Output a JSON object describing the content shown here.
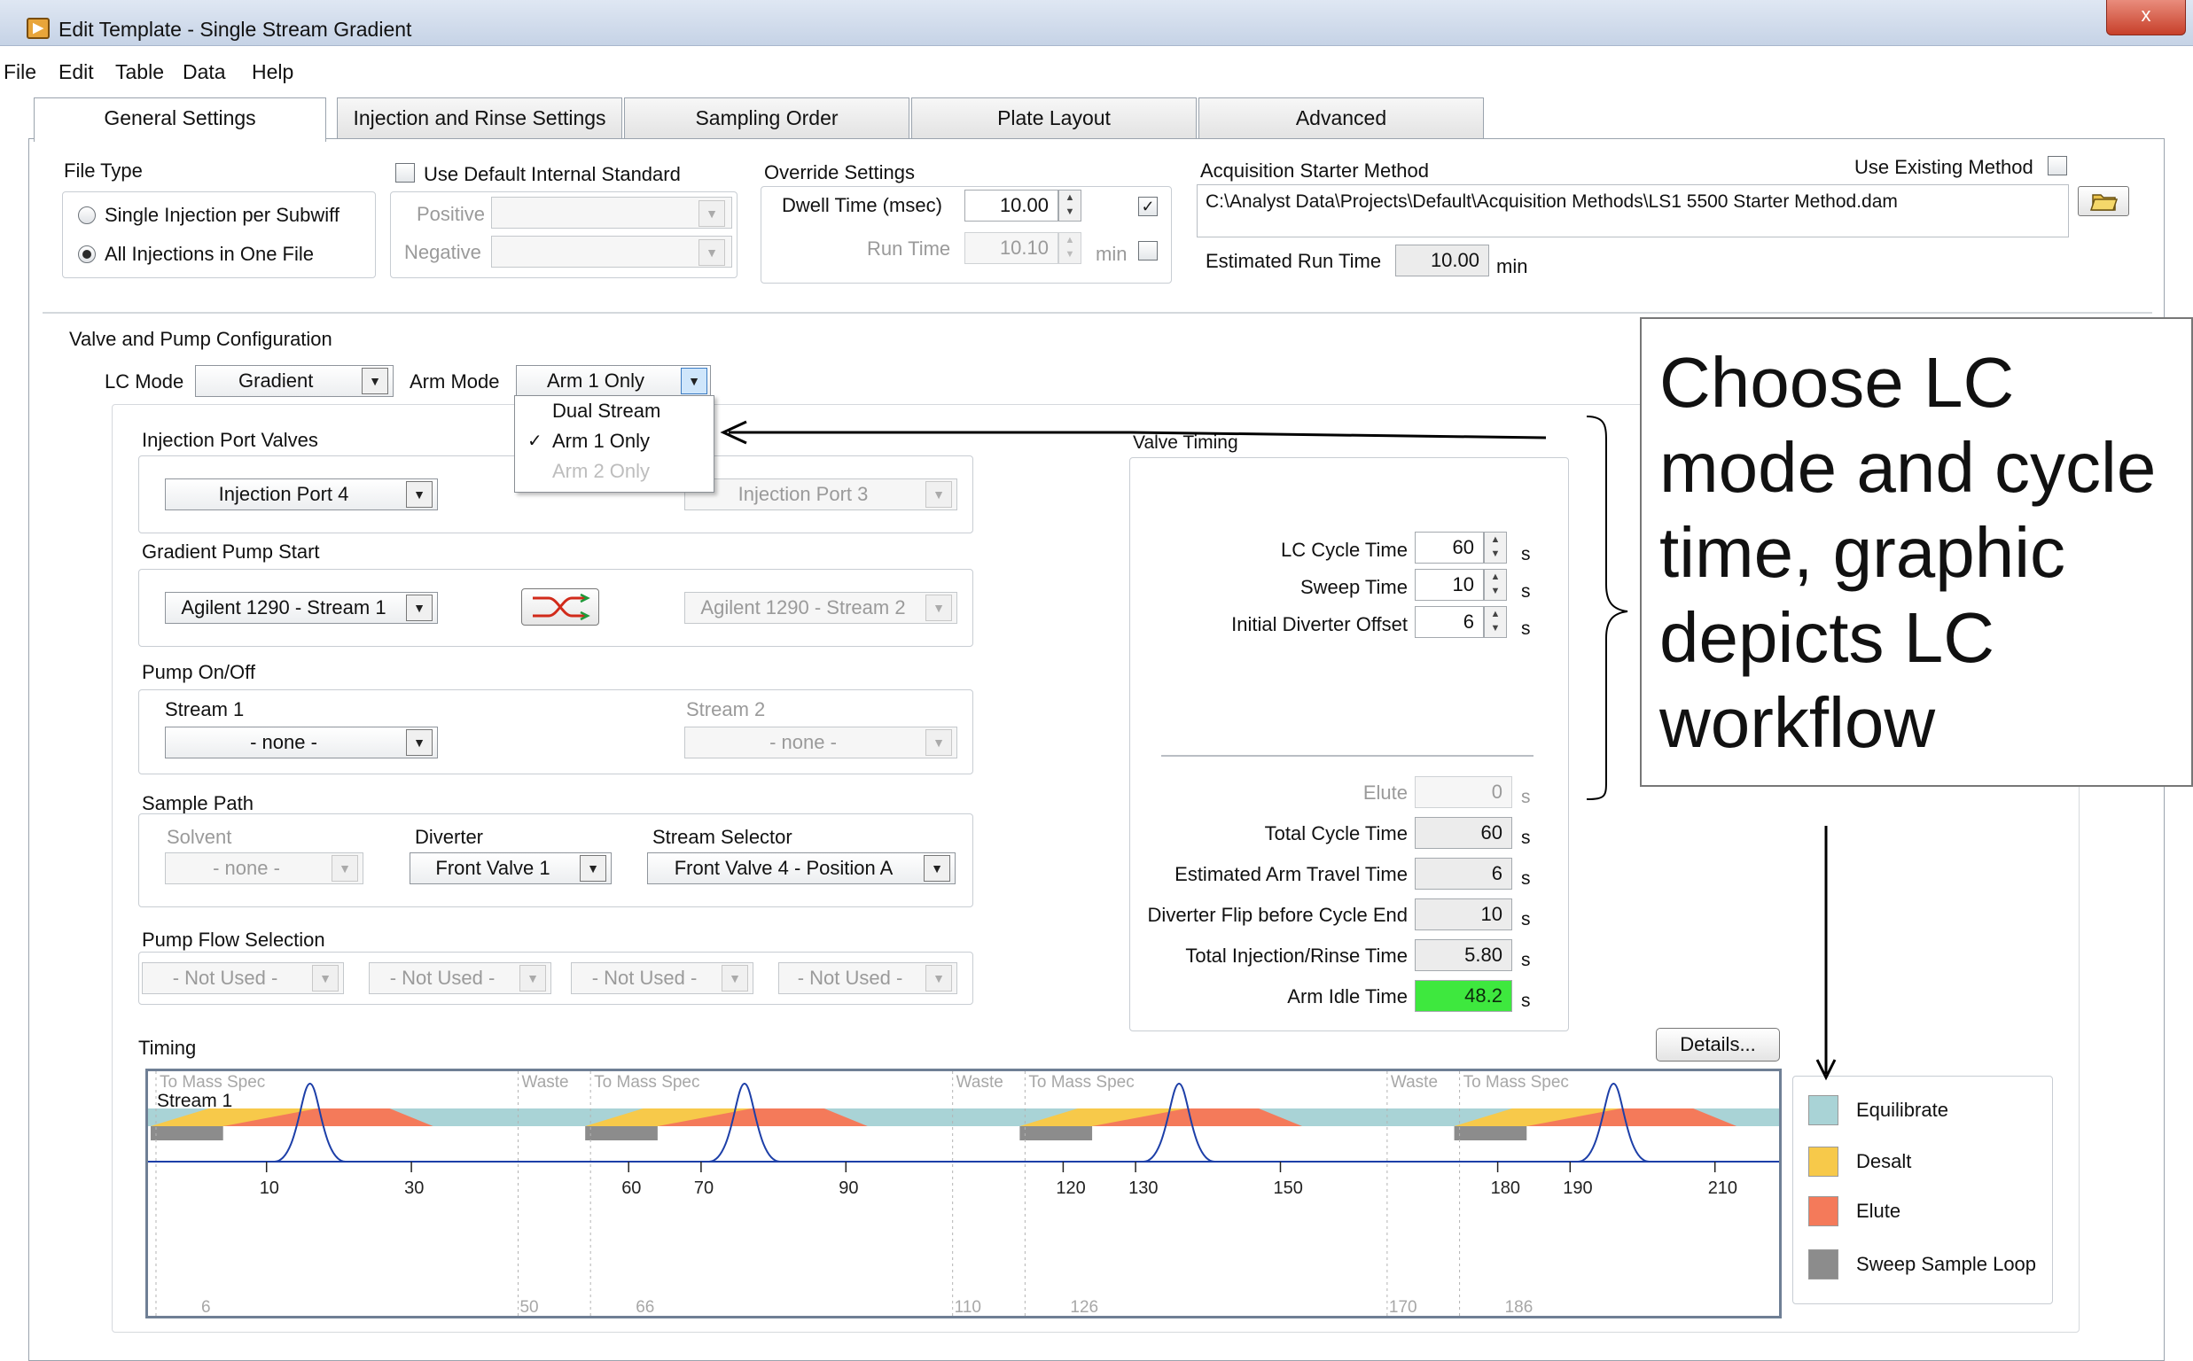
{
  "window": {
    "title": "Edit Template - Single Stream Gradient",
    "close_label": "x"
  },
  "menu": [
    "File",
    "Edit",
    "Table",
    "Data",
    "Help"
  ],
  "tabs": [
    "General Settings",
    "Injection and Rinse Settings",
    "Sampling Order",
    "Plate Layout",
    "Advanced"
  ],
  "file_type": {
    "label": "File Type",
    "options": [
      "Single Injection per Subwiff",
      "All Injections in One File"
    ],
    "selected": "All Injections in One File"
  },
  "internal_standard": {
    "label": "Use Default Internal Standard",
    "positive_label": "Positive",
    "negative_label": "Negative",
    "positive_value": "",
    "negative_value": ""
  },
  "override": {
    "label": "Override Settings",
    "dwell_label": "Dwell Time (msec)",
    "dwell_value": "10.00",
    "dwell_checked": "✓",
    "runtime_label": "Run Time",
    "runtime_value": "10.10",
    "runtime_unit": "min"
  },
  "acquisition": {
    "label": "Acquisition Starter Method",
    "use_existing_label": "Use Existing Method",
    "path": "C:\\Analyst Data\\Projects\\Default\\Acquisition Methods\\LS1 5500 Starter Method.dam",
    "est_label": "Estimated Run Time",
    "est_value": "10.00",
    "est_unit": "min"
  },
  "valve_pump": {
    "label": "Valve and Pump Configuration",
    "lc_mode_label": "LC Mode",
    "lc_mode_value": "Gradient",
    "arm_mode_label": "Arm Mode",
    "arm_mode_value": "Arm 1 Only",
    "arm_mode_options": [
      "Dual Stream",
      "Arm 1 Only",
      "Arm 2 Only"
    ],
    "check_mark": "✓"
  },
  "injection_ports": {
    "label": "Injection Port Valves",
    "left": "Injection Port 4",
    "right": "Injection Port 3"
  },
  "gradient_pump": {
    "label": "Gradient Pump Start",
    "left": "Agilent 1290 - Stream 1",
    "right": "Agilent 1290 - Stream 2"
  },
  "pump_onoff": {
    "label": "Pump On/Off",
    "stream1_label": "Stream 1",
    "stream2_label": "Stream 2",
    "stream1_value": "- none -",
    "stream2_value": "- none -"
  },
  "sample_path": {
    "label": "Sample Path",
    "solvent_label": "Solvent",
    "solvent_value": "- none -",
    "diverter_label": "Diverter",
    "diverter_value": "Front Valve 1",
    "selector_label": "Stream Selector",
    "selector_value": "Front Valve 4 - Position A"
  },
  "pump_flow": {
    "label": "Pump Flow Selection",
    "values": [
      "- Not Used -",
      "- Not Used -",
      "- Not Used -",
      "- Not Used -"
    ]
  },
  "valve_timing": {
    "label": "Valve Timing",
    "unit": "s",
    "inputs": [
      {
        "label": "LC Cycle Time",
        "value": "60"
      },
      {
        "label": "Sweep Time",
        "value": "10"
      },
      {
        "label": "Initial Diverter Offset",
        "value": "6"
      }
    ],
    "elute_label": "Elute",
    "elute_value": "0",
    "computed": [
      {
        "label": "Total Cycle Time",
        "value": "60"
      },
      {
        "label": "Estimated Arm Travel Time",
        "value": "6"
      },
      {
        "label": "Diverter Flip before Cycle End",
        "value": "10"
      },
      {
        "label": "Total Injection/Rinse Time",
        "value": "5.80"
      },
      {
        "label": "Arm Idle Time",
        "value": "48.2"
      }
    ]
  },
  "timing": {
    "label": "Timing",
    "details_label": "Details...",
    "stream_label": "Stream 1",
    "segment_labels": [
      "To Mass Spec",
      "Waste",
      "To Mass Spec",
      "Waste",
      "To Mass Spec",
      "Waste",
      "To Mass Spec"
    ],
    "ticks": [
      "10",
      "30",
      "60",
      "70",
      "90",
      "120",
      "130",
      "150",
      "180",
      "190",
      "210"
    ],
    "bottom_ticks": [
      "6",
      "50",
      "66",
      "110",
      "126",
      "170",
      "186"
    ],
    "colors": {
      "equilibrate": "#a9d3d6",
      "desalt": "#f7c94a",
      "elute": "#f47a5a",
      "sweep": "#8c8c8c"
    }
  },
  "legend": [
    "Equilibrate",
    "Desalt",
    "Elute",
    "Sweep Sample Loop"
  ],
  "callout": {
    "lines": [
      "Choose LC",
      "mode and cycle",
      "time, graphic",
      "depicts LC",
      "workflow"
    ]
  }
}
